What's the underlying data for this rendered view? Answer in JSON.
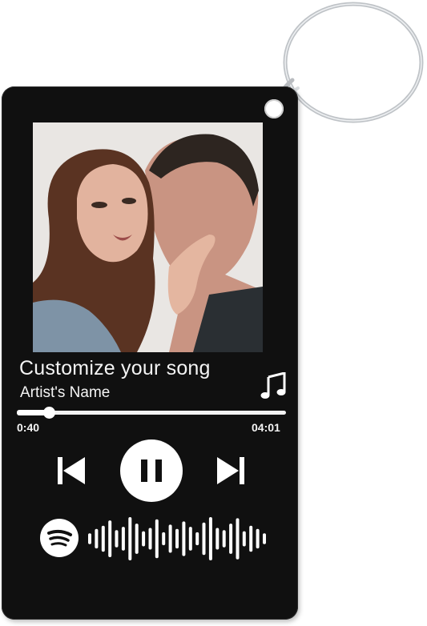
{
  "product": {
    "photo_alt": "couple photo",
    "background": "#ffffff"
  },
  "player": {
    "song_title": "Customize your song",
    "artist_name": "Artist's Name",
    "elapsed": "0:40",
    "duration": "04:01",
    "progress": 0.12,
    "accent_color": "#ffffff",
    "card_color": "#101010"
  },
  "icons": {
    "note": "music-note-icon",
    "previous": "skip-previous-icon",
    "pause": "pause-icon",
    "next": "skip-next-icon",
    "spotify": "spotify-icon",
    "code": "spotify-code-icon"
  },
  "spotify_code_bars": [
    0.25,
    0.45,
    0.6,
    0.85,
    0.4,
    0.55,
    1.0,
    0.7,
    0.35,
    0.5,
    0.9,
    0.3,
    0.65,
    0.45,
    0.8,
    0.55,
    0.3,
    0.75,
    1.0,
    0.5,
    0.4,
    0.7,
    0.95,
    0.35,
    0.6,
    0.45,
    0.25
  ]
}
